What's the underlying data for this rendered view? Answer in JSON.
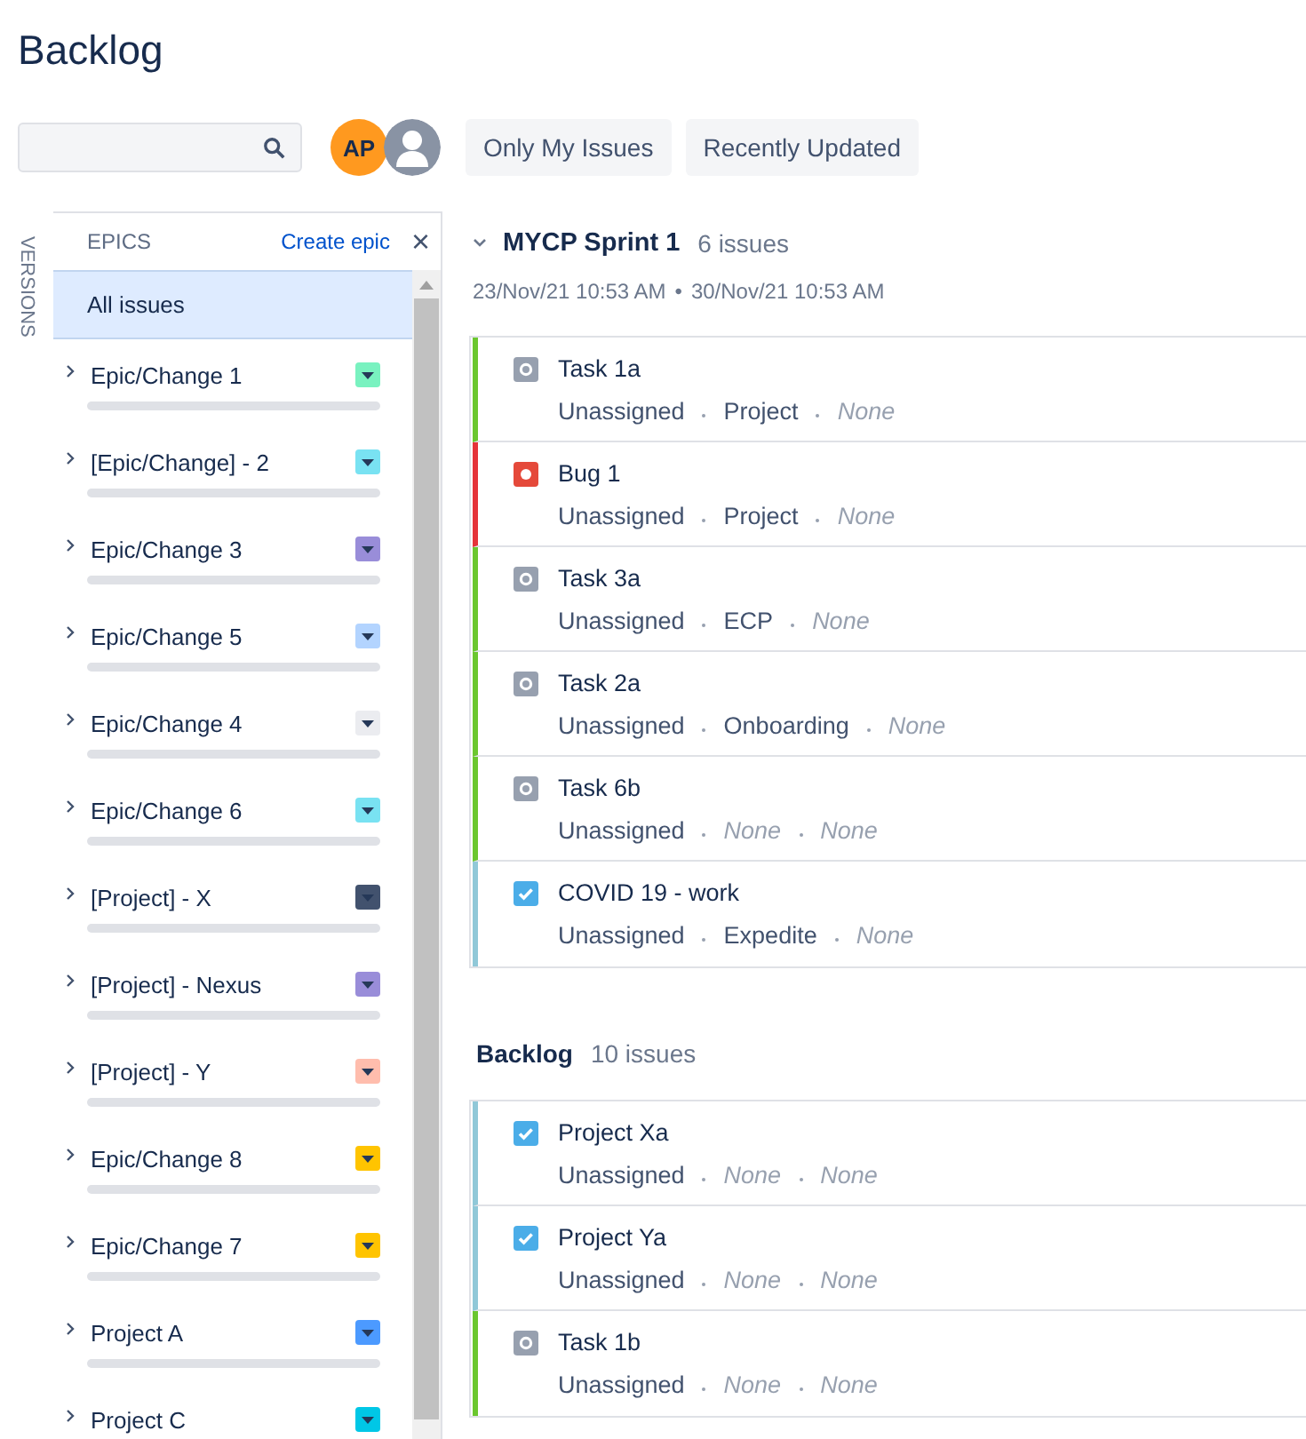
{
  "page": {
    "title": "Backlog"
  },
  "toolbar": {
    "avatars": [
      {
        "kind": "initials",
        "text": "AP",
        "color": "#ff991f"
      },
      {
        "kind": "silhouette",
        "color": "#8993a4"
      }
    ],
    "filters": [
      {
        "label": "Only My Issues",
        "selected": false
      },
      {
        "label": "Recently Updated",
        "selected": false
      }
    ]
  },
  "side_tabs": [
    {
      "label": "VERSIONS"
    }
  ],
  "epics_panel": {
    "title": "EPICS",
    "create_link": "Create epic",
    "close": "×",
    "all_issues": {
      "label": "All issues",
      "selected": true
    },
    "epics": [
      {
        "name": "Epic/Change 1",
        "color": "#79f2c0",
        "expanded": false,
        "level": 0
      },
      {
        "name": "[Epic/Change] - 2",
        "color": "#79e2f2",
        "expanded": false,
        "level": 0
      },
      {
        "name": "Epic/Change 3",
        "color": "#998dd9",
        "expanded": false,
        "level": 0
      },
      {
        "name": "Epic/Change 5",
        "color": "#b3d4ff",
        "expanded": false,
        "level": 0
      },
      {
        "name": "Epic/Change 4",
        "color": "#ebecf0",
        "expanded": false,
        "level": 0
      },
      {
        "name": "Epic/Change 6",
        "color": "#79e2f2",
        "expanded": false,
        "level": 0
      },
      {
        "name": "[Project] - X",
        "color": "#42526e",
        "expanded": false,
        "level": 0
      },
      {
        "name": "[Project] - Nexus",
        "color": "#998dd9",
        "expanded": false,
        "level": 0
      },
      {
        "name": "[Project] - Y",
        "color": "#ffbdad",
        "expanded": false,
        "level": 0
      },
      {
        "name": "Epic/Change 8",
        "color": "#ffc400",
        "expanded": false,
        "level": 0
      },
      {
        "name": "Epic/Change 7",
        "color": "#ffc400",
        "expanded": false,
        "level": 0
      },
      {
        "name": "Project A",
        "color": "#4c9aff",
        "expanded": false,
        "level": 0
      },
      {
        "name": "Project C",
        "color": "#00c7e6",
        "expanded": false
      }
    ]
  },
  "sprints": [
    {
      "kind": "sprint",
      "name": "MYCP Sprint 1",
      "count": "6 issues",
      "expanded": true,
      "start": "23/Nov/21 10:53 AM",
      "separator": "•",
      "end": "30/Nov/21 10:53 AM",
      "issues": [
        {
          "kind": "task",
          "color": "#6bc72f",
          "summary": "Task 1a",
          "fields": [
            {
              "text": "Unassigned",
              "empty": false
            },
            {
              "text": "Project",
              "empty": false
            },
            {
              "text": "None",
              "empty": true
            }
          ]
        },
        {
          "kind": "bug",
          "color": "#e5343a",
          "summary": "Bug 1",
          "fields": [
            {
              "text": "Unassigned",
              "empty": false
            },
            {
              "text": "Project",
              "empty": false
            },
            {
              "text": "None",
              "empty": true
            }
          ]
        },
        {
          "kind": "task",
          "color": "#6bc72f",
          "summary": "Task 3a",
          "fields": [
            {
              "text": "Unassigned",
              "empty": false
            },
            {
              "text": "ECP",
              "empty": false
            },
            {
              "text": "None",
              "empty": true
            }
          ]
        },
        {
          "kind": "task",
          "color": "#6bc72f",
          "summary": "Task 2a",
          "fields": [
            {
              "text": "Unassigned",
              "empty": false
            },
            {
              "text": "Onboarding",
              "empty": false
            },
            {
              "text": "None",
              "empty": true
            }
          ]
        },
        {
          "kind": "task",
          "color": "#6bc72f",
          "summary": "Task 6b",
          "fields": [
            {
              "text": "Unassigned",
              "empty": false
            },
            {
              "text": "None",
              "empty": true
            },
            {
              "text": "None",
              "empty": true
            }
          ]
        },
        {
          "kind": "done",
          "color": "#90c8d8",
          "summary": "COVID 19 - work",
          "fields": [
            {
              "text": "Unassigned",
              "empty": false
            },
            {
              "text": "Expedite",
              "empty": false
            },
            {
              "text": "None",
              "empty": true
            }
          ]
        }
      ]
    },
    {
      "kind": "backlog",
      "name": "Backlog",
      "count": "10 issues",
      "issues": [
        {
          "kind": "done",
          "color": "#90c8d8",
          "summary": "Project Xa",
          "fields": [
            {
              "text": "Unassigned",
              "empty": false
            },
            {
              "text": "None",
              "empty": true
            },
            {
              "text": "None",
              "empty": true
            }
          ]
        },
        {
          "kind": "done",
          "color": "#90c8d8",
          "summary": "Project Ya",
          "fields": [
            {
              "text": "Unassigned",
              "empty": false
            },
            {
              "text": "None",
              "empty": true
            },
            {
              "text": "None",
              "empty": true
            }
          ]
        },
        {
          "kind": "task",
          "color": "#6bc72f",
          "summary": "Task 1b",
          "fields": [
            {
              "text": "Unassigned",
              "empty": false
            },
            {
              "text": "None",
              "empty": true
            },
            {
              "text": "None",
              "empty": true
            }
          ]
        }
      ]
    }
  ]
}
